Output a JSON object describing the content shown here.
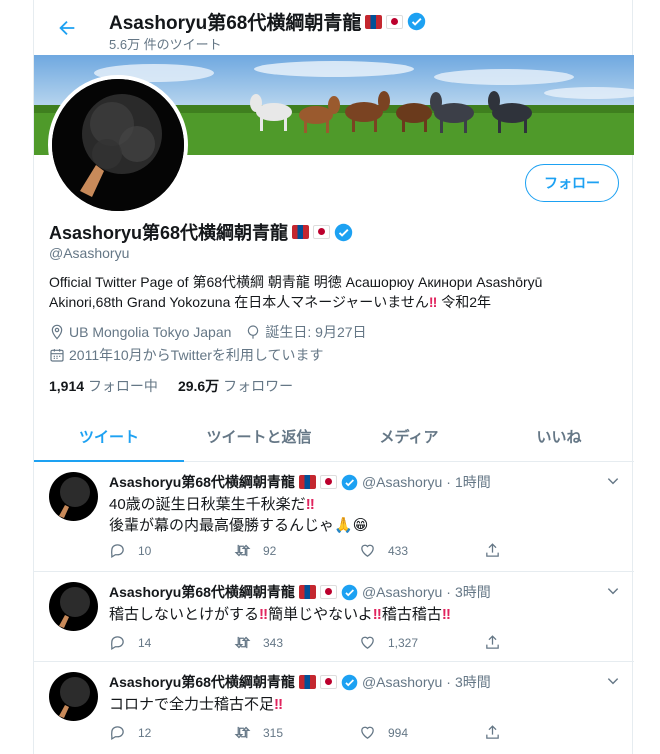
{
  "header": {
    "title": "Asashoryu第68代横綱朝青龍",
    "tweet_count": "5.6万 件のツイート"
  },
  "profile": {
    "name": "Asashoryu第68代横綱朝青龍",
    "handle": "@Asashoryu",
    "follow_label": "フォロー",
    "bio_line1": "Official Twitter Page of 第68代横綱 朝青龍 明徳 Асашорюу Акинори Asashōryū",
    "bio_line2a": "Akinori,68th Grand Yokozuna 在日本人マネージャーいません",
    "bio_bang": "‼",
    "bio_line2b": " 令和2年",
    "location": "UB Mongolia Tokyo Japan",
    "birthday": "誕生日: 9月27日",
    "joined": "2011年10月からTwitterを利用しています",
    "following_count": "1,914",
    "following_label": "フォロー中",
    "followers_count": "29.6万",
    "followers_label": "フォロワー"
  },
  "tabs": [
    {
      "label": "ツイート"
    },
    {
      "label": "ツイートと返信"
    },
    {
      "label": "メディア"
    },
    {
      "label": "いいね"
    }
  ],
  "tweets": [
    {
      "name": "Asashoryu第68代横綱朝青龍",
      "handle": "@Asashoryu",
      "time": "1時間",
      "line1": "40歳の誕生日秋葉生千秋楽だ",
      "line1_bang": "‼",
      "line2": "後輩が幕の内最高優勝するんじゃ",
      "line2_emoji": "🙏😁",
      "replies": "10",
      "retweets": "92",
      "likes": "433"
    },
    {
      "name": "Asashoryu第68代横綱朝青龍",
      "handle": "@Asashoryu",
      "time": "3時間",
      "seg1": "稽古しないとけがする",
      "seg2": "簡単じやないよ",
      "seg3": "稽古稽古",
      "bang": "‼",
      "replies": "14",
      "retweets": "343",
      "likes": "1,327"
    },
    {
      "name": "Asashoryu第68代横綱朝青龍",
      "handle": "@Asashoryu",
      "time": "3時間",
      "line1": "コロナで全力士稽古不足",
      "line1_bang": "‼",
      "replies": "12",
      "retweets": "315",
      "likes": "994"
    }
  ],
  "colors": {
    "accent": "#1da1f2",
    "muted": "#657786",
    "border": "#e6ecf0",
    "bang": "#e0245e"
  },
  "icons": [
    "back-arrow-icon",
    "verified-icon",
    "location-icon",
    "birthday-icon",
    "calendar-icon",
    "reply-icon",
    "retweet-icon",
    "like-icon",
    "share-icon",
    "caret-down-icon"
  ]
}
